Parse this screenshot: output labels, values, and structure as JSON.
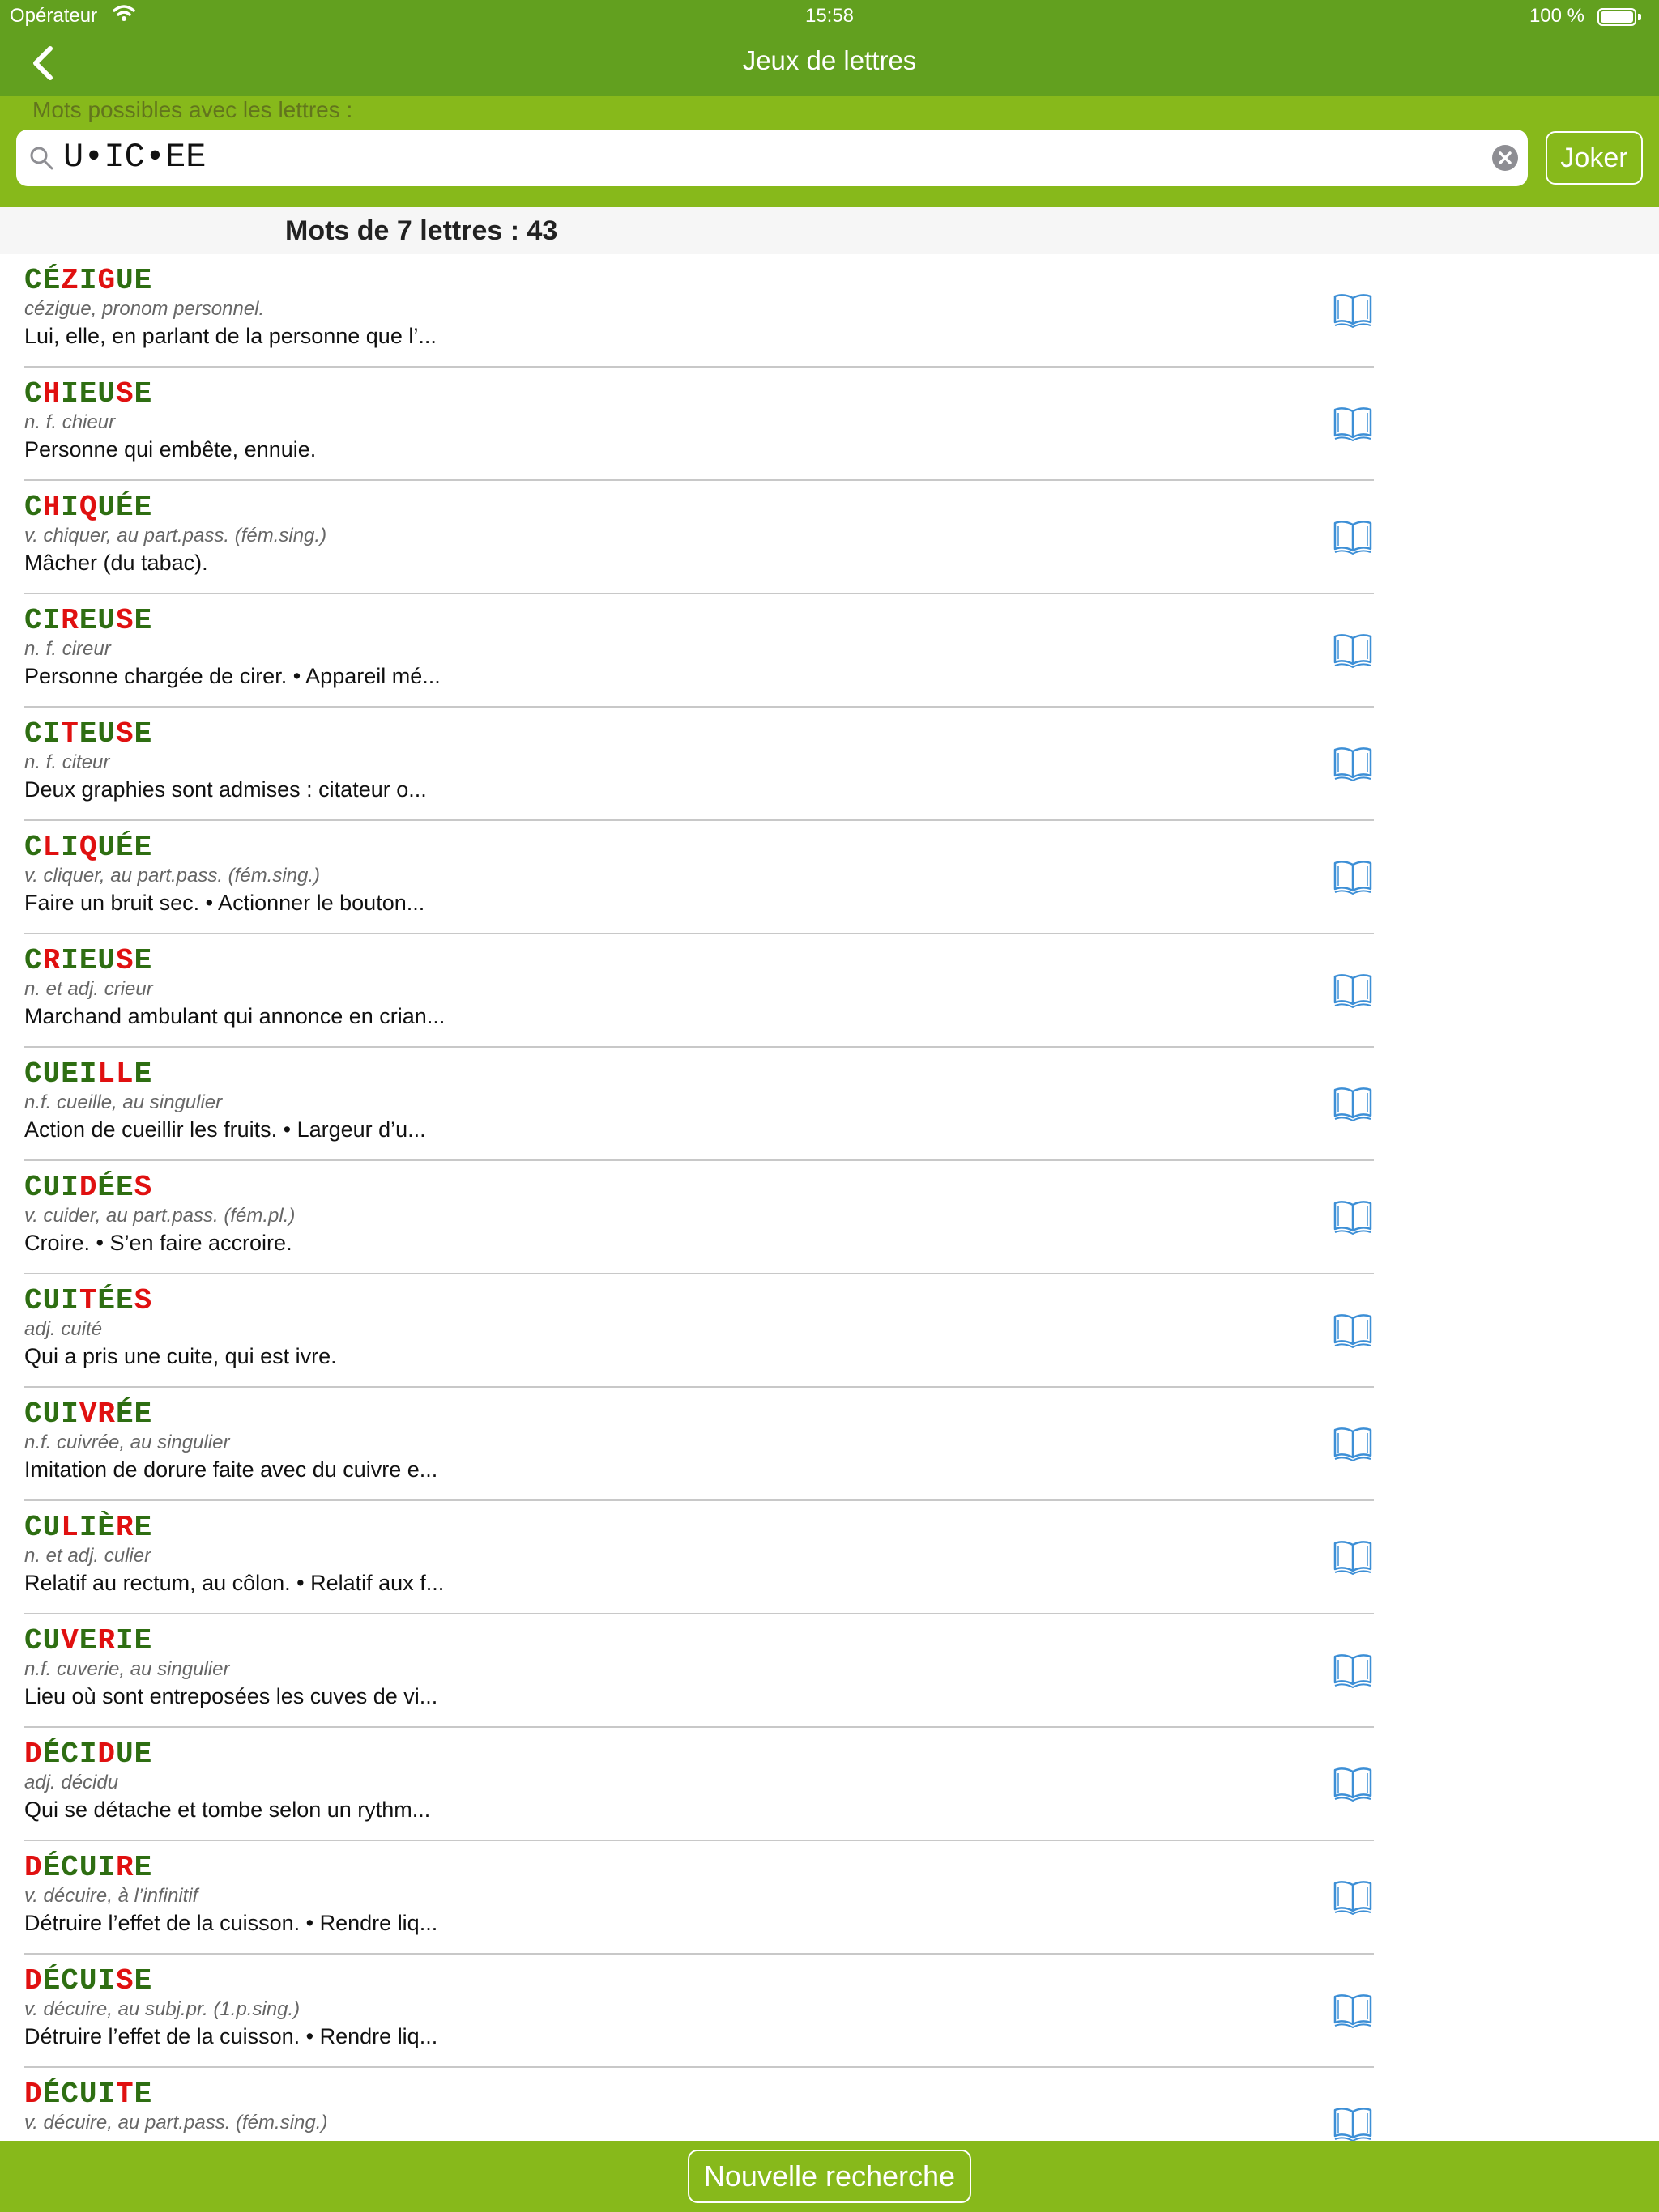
{
  "status_bar": {
    "carrier": "Opérateur",
    "time": "15:58",
    "battery": "100 %"
  },
  "nav": {
    "title": "Jeux de lettres"
  },
  "search": {
    "label": "Mots possibles avec les lettres :",
    "value": "U•IC•EE",
    "joker_label": "Joker"
  },
  "section": {
    "title": "Mots de 7 lettres : 43"
  },
  "colors": {
    "header_green": "#62a01f",
    "search_green": "#87b91b",
    "letter_green": "#2e6e12",
    "letter_red": "#e01010",
    "icon_blue": "#3d8fd6"
  },
  "results": [
    {
      "letters": [
        [
          "CÉ",
          "g"
        ],
        [
          "Z",
          "r"
        ],
        [
          "I",
          "g"
        ],
        [
          "G",
          "r"
        ],
        [
          "UE",
          "g"
        ]
      ],
      "type": "cézigue, pronom personnel.",
      "definition": "Lui, elle, en parlant de la personne que l’..."
    },
    {
      "letters": [
        [
          "C",
          "g"
        ],
        [
          "H",
          "r"
        ],
        [
          "IEU",
          "g"
        ],
        [
          "S",
          "r"
        ],
        [
          "E",
          "g"
        ]
      ],
      "type": "n. f. chieur",
      "definition": "Personne qui embête, ennuie."
    },
    {
      "letters": [
        [
          "C",
          "g"
        ],
        [
          "H",
          "r"
        ],
        [
          "I",
          "g"
        ],
        [
          "Q",
          "r"
        ],
        [
          "UÉE",
          "g"
        ]
      ],
      "type": "v. chiquer, au part.pass. (fém.sing.)",
      "definition": "Mâcher (du tabac)."
    },
    {
      "letters": [
        [
          "CI",
          "g"
        ],
        [
          "R",
          "r"
        ],
        [
          "EU",
          "g"
        ],
        [
          "S",
          "r"
        ],
        [
          "E",
          "g"
        ]
      ],
      "type": "n. f. cireur",
      "definition": "Personne chargée de cirer. • Appareil mé..."
    },
    {
      "letters": [
        [
          "CI",
          "g"
        ],
        [
          "T",
          "r"
        ],
        [
          "EU",
          "g"
        ],
        [
          "S",
          "r"
        ],
        [
          "E",
          "g"
        ]
      ],
      "type": "n. f. citeur",
      "definition": "Deux graphies sont admises :  citateur o..."
    },
    {
      "letters": [
        [
          "C",
          "g"
        ],
        [
          "L",
          "r"
        ],
        [
          "I",
          "g"
        ],
        [
          "Q",
          "r"
        ],
        [
          "UÉE",
          "g"
        ]
      ],
      "type": "v. cliquer, au part.pass. (fém.sing.)",
      "definition": "Faire un bruit sec. • Actionner le bouton..."
    },
    {
      "letters": [
        [
          "C",
          "g"
        ],
        [
          "R",
          "r"
        ],
        [
          "IEU",
          "g"
        ],
        [
          "S",
          "r"
        ],
        [
          "E",
          "g"
        ]
      ],
      "type": "n. et adj. crieur",
      "definition": "Marchand ambulant qui annonce en crian..."
    },
    {
      "letters": [
        [
          "CUEI",
          "g"
        ],
        [
          "LL",
          "r"
        ],
        [
          "E",
          "g"
        ]
      ],
      "type": "n.f. cueille, au singulier",
      "definition": "Action de cueillir les fruits. • Largeur d’u..."
    },
    {
      "letters": [
        [
          "CUI",
          "g"
        ],
        [
          "D",
          "r"
        ],
        [
          "ÉE",
          "g"
        ],
        [
          "S",
          "r"
        ]
      ],
      "type": "v. cuider, au part.pass. (fém.pl.)",
      "definition": "Croire. • S’en faire accroire."
    },
    {
      "letters": [
        [
          "CUI",
          "g"
        ],
        [
          "T",
          "r"
        ],
        [
          "ÉE",
          "g"
        ],
        [
          "S",
          "r"
        ]
      ],
      "type": "adj. cuité",
      "definition": "Qui a pris une cuite, qui est ivre."
    },
    {
      "letters": [
        [
          "CUI",
          "g"
        ],
        [
          "VR",
          "r"
        ],
        [
          "ÉE",
          "g"
        ]
      ],
      "type": "n.f. cuivrée, au singulier",
      "definition": "Imitation de dorure faite avec du cuivre e..."
    },
    {
      "letters": [
        [
          "CU",
          "g"
        ],
        [
          "L",
          "r"
        ],
        [
          "IÈ",
          "g"
        ],
        [
          "R",
          "r"
        ],
        [
          "E",
          "g"
        ]
      ],
      "type": "n. et adj. culier",
      "definition": "Relatif au rectum, au côlon. • Relatif aux f..."
    },
    {
      "letters": [
        [
          "CU",
          "g"
        ],
        [
          "V",
          "r"
        ],
        [
          "E",
          "g"
        ],
        [
          "R",
          "r"
        ],
        [
          "IE",
          "g"
        ]
      ],
      "type": "n.f. cuverie, au singulier",
      "definition": "Lieu où sont entreposées les cuves de vi..."
    },
    {
      "letters": [
        [
          "D",
          "r"
        ],
        [
          "ÉCI",
          "g"
        ],
        [
          "D",
          "r"
        ],
        [
          "UE",
          "g"
        ]
      ],
      "type": "adj. décidu",
      "definition": "Qui se détache et tombe selon un rythm..."
    },
    {
      "letters": [
        [
          "D",
          "r"
        ],
        [
          "ÉCUI",
          "g"
        ],
        [
          "R",
          "r"
        ],
        [
          "E",
          "g"
        ]
      ],
      "type": "v. décuire, à l’infinitif",
      "definition": "Détruire l’effet de la cuisson. • Rendre liq..."
    },
    {
      "letters": [
        [
          "D",
          "r"
        ],
        [
          "ÉCUI",
          "g"
        ],
        [
          "S",
          "r"
        ],
        [
          "E",
          "g"
        ]
      ],
      "type": "v. décuire, au subj.pr. (1.p.sing.)",
      "definition": "Détruire l’effet de la cuisson. • Rendre liq..."
    },
    {
      "letters": [
        [
          "D",
          "r"
        ],
        [
          "ÉCUI",
          "g"
        ],
        [
          "T",
          "r"
        ],
        [
          "E",
          "g"
        ]
      ],
      "type": "v. décuire, au part.pass. (fém.sing.)",
      "definition": ""
    }
  ],
  "bottom": {
    "new_search_label": "Nouvelle recherche"
  }
}
